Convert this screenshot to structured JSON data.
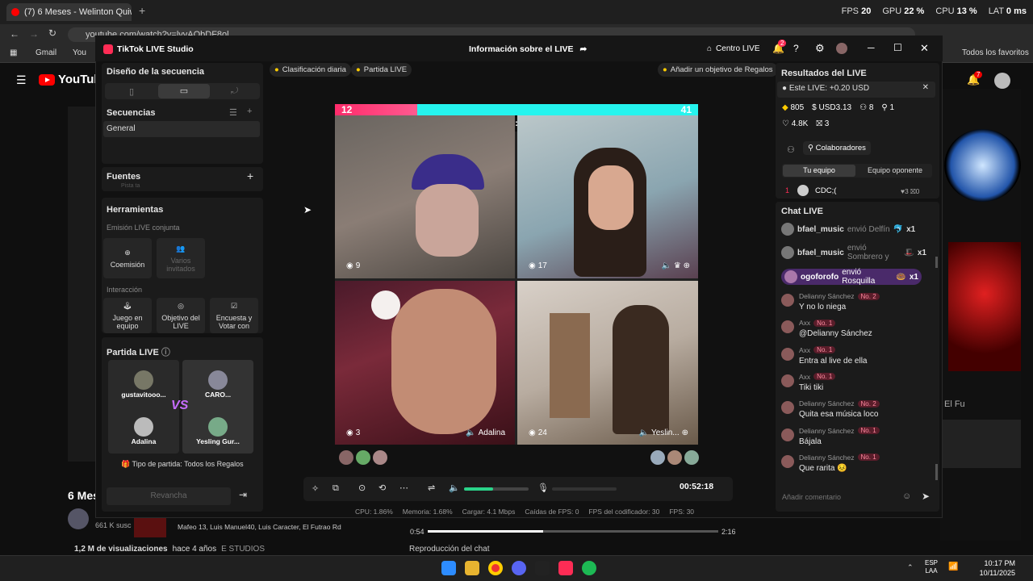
{
  "browser": {
    "tab_title": "(7) 6 Meses - Welinton Quiw (S...",
    "url": "youtube.com/watch?v=lvvAQbDF8ol",
    "bookmarks": [
      "Gmail",
      "You"
    ],
    "bookmarks_right": "Todos los favoritos"
  },
  "perf": {
    "fps_label": "FPS",
    "fps": "20",
    "gpu_label": "GPU",
    "gpu": "22 %",
    "cpu_label": "CPU",
    "cpu": "13 %",
    "lat_label": "LAT",
    "lat": "0 ms"
  },
  "youtube": {
    "logo": "YouTube",
    "title_fragment": "6 Mes",
    "subs": "661 K susc",
    "views": "1,2 M de visualizaciones",
    "ago": "hace 4 años",
    "studio_tag": "E STUDIOS",
    "now_playing": "Mafeo 13, Luis Manuel40, Luis Caracter, El Futrao Rd",
    "time_cur": "0:54",
    "time_total": "2:16",
    "chat_replay": "Reproducción del chat",
    "side_text": "El Fu",
    "notif_count": "7"
  },
  "studio": {
    "app_title": "TikTok LIVE Studio",
    "center_title": "Información sobre el LIVE",
    "centro_live": "Centro LIVE",
    "notif_badge": "2",
    "left": {
      "seq_design": "Diseño de la secuencia",
      "sequences": "Secuencias",
      "general": "General",
      "sources": "Fuentes",
      "source_cut": "Pista ta",
      "tools": "Herramientas",
      "joint": "Emisión LIVE conjunta",
      "tool_coemision": "Coemisión",
      "tool_varios": "Varios invitados",
      "interaction": "Interacción",
      "tool_juego": "Juego en equipo",
      "tool_objetivo": "Objetivo del LIVE",
      "tool_encuesta": "Encuesta y Votar con",
      "partida": "Partida LIVE",
      "players": [
        "gustavitooo...",
        "CARO...",
        "Adalina",
        "Yesling Gur..."
      ],
      "vs": "VS",
      "match_type": "Tipo de partida: Todos los Regalos",
      "rematch": "Revancha"
    },
    "center": {
      "chip_daily": "Clasificación diaria",
      "chip_match": "Partida LIVE",
      "chip_goal": "Añadir un objetivo de Regalos",
      "score_left": "12",
      "score_right": "41",
      "timer": "00:13",
      "video_counts": [
        "9",
        "17",
        "3",
        "24"
      ],
      "video_names": [
        "Adalina",
        "Yeslin..."
      ],
      "stream_time": "00:52:18",
      "stats": {
        "cpu": "CPU: 1.86%",
        "mem": "Memoria: 1.68%",
        "load": "Cargar: 4.1 Mbps",
        "fps_drop": "Caídas de FPS: 0",
        "enc_fps": "FPS del codificador: 30",
        "fps": "FPS: 30"
      }
    },
    "right": {
      "results_title": "Resultados del LIVE",
      "this_live": "Este LIVE: +0.20 USD",
      "diamonds": "805",
      "usd": "USD3.13",
      "viewers": "8",
      "new": "1",
      "likes": "4.8K",
      "gifts": "3",
      "collab": "Colaboradores",
      "tab_team": "Tu equipo",
      "tab_opp": "Equipo oponente",
      "rank_num": "1",
      "rank_name": "CDC;(",
      "rank_a": "3",
      "rank_b": "0",
      "chat_title": "Chat LIVE",
      "gifts_list": [
        {
          "user": "bfael_music",
          "action": "envió Delfín",
          "count": "x1"
        },
        {
          "user": "bfael_music",
          "action": "envió Sombrero y",
          "count": "x1"
        },
        {
          "user": "ogoforofo",
          "action": "envió Rosquilla",
          "count": "x1"
        }
      ],
      "messages": [
        {
          "user": "Delianny Sánchez",
          "badge": "No. 2",
          "text": "Y no lo niega"
        },
        {
          "user": "Axx",
          "badge": "No. 1",
          "text": "@Delianny Sánchez"
        },
        {
          "user": "Axx",
          "badge": "No. 1",
          "text": "Entra al live de ella"
        },
        {
          "user": "Axx",
          "badge": "No. 1",
          "text": "Tiki tiki"
        },
        {
          "user": "Delianny Sánchez",
          "badge": "No. 2",
          "text": "Quita esa música loco"
        },
        {
          "user": "Delianny Sánchez",
          "badge": "No. 1",
          "text": "Bájala"
        },
        {
          "user": "Delianny Sánchez",
          "badge": "No. 1",
          "text": "Que rarita 😣"
        }
      ],
      "comment_placeholder": "Añadir comentario"
    }
  },
  "taskbar": {
    "lang": "ESP",
    "lang2": "LAA",
    "time": "10:17 PM",
    "date": "10/11/2025"
  },
  "colors": {
    "accent_pink": "#ff2c6b",
    "accent_cyan": "#25f4ee",
    "green": "#2ad48a"
  }
}
